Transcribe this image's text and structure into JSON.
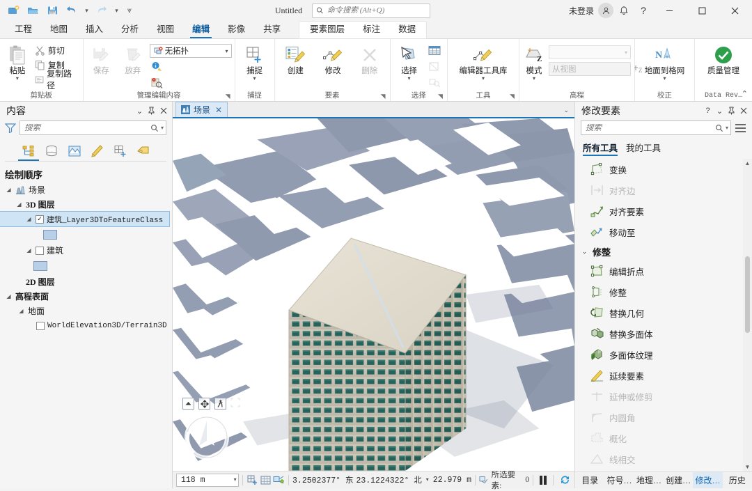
{
  "titlebar": {
    "quick_access": [
      {
        "name": "new-project-icon",
        "label": "新建工程"
      },
      {
        "name": "open-project-icon",
        "label": "打开工程"
      },
      {
        "name": "save-project-icon",
        "label": "保存工程"
      },
      {
        "name": "undo-icon",
        "label": "撤消"
      },
      {
        "name": "redo-icon",
        "label": "恢复"
      },
      {
        "name": "customize-qat-icon",
        "label": "自定义快速访问工具栏"
      }
    ],
    "document_title": "Untitled",
    "command_search_placeholder": "命令搜索 (Alt+Q)",
    "sign_in": "未登录",
    "help": "?",
    "minimize": "—",
    "maximize": "☐",
    "close": "✕"
  },
  "ribbon": {
    "tabs": [
      {
        "label": "工程",
        "active": false
      },
      {
        "label": "地图",
        "active": false
      },
      {
        "label": "插入",
        "active": false
      },
      {
        "label": "分析",
        "active": false
      },
      {
        "label": "视图",
        "active": false
      },
      {
        "label": "编辑",
        "active": true
      },
      {
        "label": "影像",
        "active": false
      },
      {
        "label": "共享",
        "active": false
      }
    ],
    "contextual_tabs": [
      {
        "label": "要素图层",
        "active": false
      },
      {
        "label": "标注",
        "active": false
      },
      {
        "label": "数据",
        "active": false
      }
    ],
    "groups": [
      {
        "title": "剪贴板",
        "big": {
          "label": "粘贴",
          "has_dropdown": true
        },
        "items": [
          {
            "label": "剪切",
            "disabled": false
          },
          {
            "label": "复制",
            "disabled": false
          },
          {
            "label": "复制路径",
            "disabled": false
          }
        ]
      },
      {
        "title": "管理编辑内容",
        "buttons": [
          {
            "label": "保存",
            "disabled": true
          },
          {
            "label": "放弃",
            "disabled": true
          }
        ],
        "topology_value": "无拓扑"
      },
      {
        "title": "捕捉",
        "big": {
          "label": "捕捉",
          "has_dropdown": true
        }
      },
      {
        "title": "要素",
        "buttons": [
          {
            "label": "创建",
            "disabled": false
          },
          {
            "label": "修改",
            "disabled": false
          },
          {
            "label": "删除",
            "disabled": true
          }
        ]
      },
      {
        "title": "选择",
        "big": {
          "label": "选择",
          "has_dropdown": true
        }
      },
      {
        "title": "工具",
        "big": {
          "label": "编辑器工具库",
          "has_dropdown": true
        }
      },
      {
        "title": "高程",
        "big": {
          "label": "模式",
          "has_dropdown": true
        },
        "z_source": "从视图"
      },
      {
        "title": "校正",
        "big": {
          "label": "地面到格网",
          "has_dropdown": true
        }
      },
      {
        "title": "Data Rev…",
        "big": {
          "label": "质量管理",
          "has_dropdown": false
        }
      }
    ]
  },
  "contents_panel": {
    "title": "内容",
    "search_placeholder": "搜索",
    "icon_tabs": [
      {
        "name": "list-by-drawing-order-icon",
        "active": true
      },
      {
        "name": "list-by-data-source-icon",
        "active": false
      },
      {
        "name": "list-by-selection-icon",
        "active": false
      },
      {
        "name": "list-by-editing-icon",
        "active": false
      },
      {
        "name": "list-by-snapping-icon",
        "active": false
      },
      {
        "name": "list-by-labeling-icon",
        "active": false
      }
    ],
    "heading": "绘制顺序",
    "tree": [
      {
        "label": "场景",
        "indent": 0,
        "tri": "open",
        "icon": "scene-icon",
        "checkbox": null,
        "style": "normal"
      },
      {
        "label": "3D 图层",
        "indent": 1,
        "tri": "open",
        "icon": null,
        "checkbox": null,
        "style": "bold"
      },
      {
        "label": "建筑_Layer3DToFeatureClass",
        "indent": 2,
        "tri": "open",
        "icon": null,
        "checkbox": true,
        "style": "mono",
        "selected": true
      },
      {
        "label": "",
        "indent": 3,
        "tri": "none",
        "icon": null,
        "checkbox": null,
        "style": "swatch"
      },
      {
        "label": "建筑",
        "indent": 2,
        "tri": "open",
        "icon": null,
        "checkbox": false,
        "style": "normal"
      },
      {
        "label": "",
        "indent": 3,
        "tri": "none",
        "icon": null,
        "checkbox": null,
        "style": "swatch"
      },
      {
        "label": "2D 图层",
        "indent": 1,
        "tri": "none",
        "icon": null,
        "checkbox": null,
        "style": "bold"
      },
      {
        "label": "高程表面",
        "indent": 0,
        "tri": "open",
        "icon": null,
        "checkbox": null,
        "style": "bold"
      },
      {
        "label": "地面",
        "indent": 1,
        "tri": "open",
        "icon": null,
        "checkbox": null,
        "style": "normal"
      },
      {
        "label": "WorldElevation3D/Terrain3D",
        "indent": 2,
        "tri": "none",
        "icon": null,
        "checkbox": false,
        "style": "mono"
      }
    ]
  },
  "view": {
    "tab_label": "场景",
    "tab_close": "✕",
    "overflow_chevron": "⌄",
    "map_controls": [
      {
        "name": "pan-up-icon"
      },
      {
        "name": "move-icon"
      },
      {
        "name": "walk-icon"
      },
      {
        "name": "full-control-icon"
      }
    ],
    "navigator_name": "navigator-compass"
  },
  "statusbar": {
    "scale": "118 m",
    "icons": [
      {
        "name": "add-grid-icon"
      },
      {
        "name": "grid-icon"
      },
      {
        "name": "selection-info-icon"
      }
    ],
    "longitude": "3.2502377° 东",
    "latitude": "23.1224322° 北",
    "elevation": "22.979 m",
    "selected_label": "所选要素:",
    "selected_count": "0",
    "pause_name": "pause-drawing-button",
    "refresh_name": "refresh-button"
  },
  "modify_panel": {
    "title": "修改要素",
    "help": "?",
    "search_placeholder": "搜索",
    "menu_icon": "hamburger-menu-icon",
    "tabs": [
      {
        "label": "所有工具",
        "active": true
      },
      {
        "label": "我的工具",
        "active": false
      }
    ],
    "tools": [
      {
        "label": "变换",
        "icon": "transform-icon",
        "disabled": false,
        "type": "tool"
      },
      {
        "label": "对齐边",
        "icon": "align-edge-icon",
        "disabled": true,
        "type": "tool"
      },
      {
        "label": "对齐要素",
        "icon": "align-features-icon",
        "disabled": false,
        "type": "tool"
      },
      {
        "label": "移动至",
        "icon": "move-to-icon",
        "disabled": false,
        "type": "tool"
      },
      {
        "label": "修整",
        "icon": null,
        "disabled": false,
        "type": "section"
      },
      {
        "label": "编辑折点",
        "icon": "edit-vertices-icon",
        "disabled": false,
        "type": "tool"
      },
      {
        "label": "修整",
        "icon": "reshape-icon",
        "disabled": false,
        "type": "tool"
      },
      {
        "label": "替换几何",
        "icon": "replace-geometry-icon",
        "disabled": false,
        "type": "tool"
      },
      {
        "label": "替换多面体",
        "icon": "replace-multipatch-icon",
        "disabled": false,
        "type": "tool"
      },
      {
        "label": "多面体纹理",
        "icon": "multipatch-texture-icon",
        "disabled": false,
        "type": "tool"
      },
      {
        "label": "延续要素",
        "icon": "continue-feature-icon",
        "disabled": false,
        "type": "tool"
      },
      {
        "label": "延伸或修剪",
        "icon": "extend-trim-icon",
        "disabled": true,
        "type": "tool"
      },
      {
        "label": "内圆角",
        "icon": "fillet-icon",
        "disabled": true,
        "type": "tool"
      },
      {
        "label": "概化",
        "icon": "generalize-icon",
        "disabled": true,
        "type": "tool"
      },
      {
        "label": "线相交",
        "icon": "line-intersection-icon",
        "disabled": true,
        "type": "tool"
      }
    ],
    "bottom_tabs": [
      {
        "label": "目录",
        "active": false
      },
      {
        "label": "符号…",
        "active": false
      },
      {
        "label": "地理…",
        "active": false
      },
      {
        "label": "创建…",
        "active": false
      },
      {
        "label": "修改…",
        "active": true
      },
      {
        "label": "历史",
        "active": false
      }
    ]
  },
  "colors": {
    "accent": "#1b74b8",
    "building_mass": "#8e98ad",
    "building_facade": "#d8d2c4",
    "window": "#2a6a63",
    "roof": "#e4ded0",
    "sky": "#ffffff"
  }
}
